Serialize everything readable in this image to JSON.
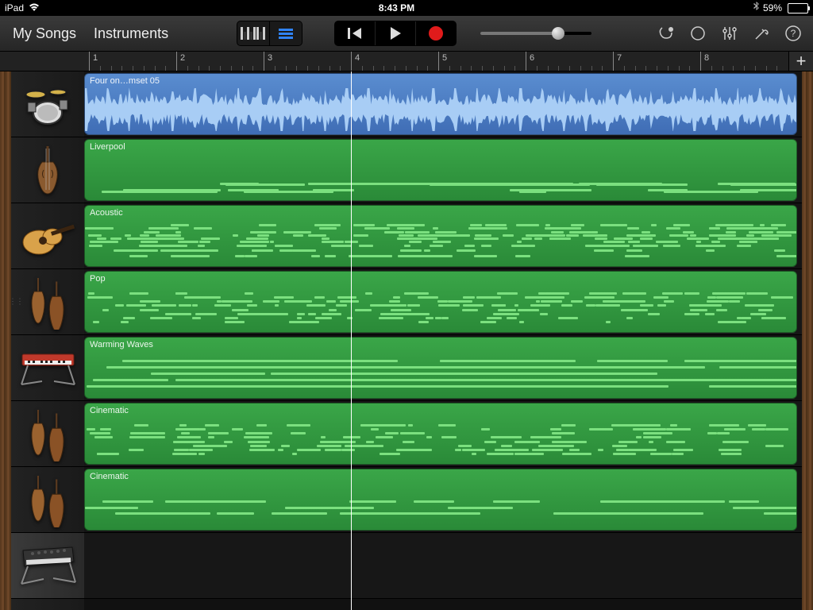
{
  "status": {
    "device": "iPad",
    "time": "8:43 PM",
    "battery_pct": "59%",
    "battery_fill": 59
  },
  "toolbar": {
    "my_songs": "My Songs",
    "instruments": "Instruments"
  },
  "ruler": {
    "bars": [
      "1",
      "2",
      "3",
      "4",
      "5",
      "6",
      "7",
      "8"
    ]
  },
  "playhead_bar": 4,
  "volume_pct": 70,
  "tracks": [
    {
      "name": "Four on…mset 05",
      "type": "audio",
      "instrument": "drums"
    },
    {
      "name": "Liverpool",
      "type": "midi",
      "instrument": "bass"
    },
    {
      "name": "Acoustic",
      "type": "midi",
      "instrument": "guitar"
    },
    {
      "name": "Pop",
      "type": "midi",
      "instrument": "strings"
    },
    {
      "name": "Warming Waves",
      "type": "midi",
      "instrument": "keyboard"
    },
    {
      "name": "Cinematic",
      "type": "midi",
      "instrument": "strings"
    },
    {
      "name": "Cinematic",
      "type": "midi",
      "instrument": "strings"
    },
    {
      "name": "",
      "type": "empty",
      "instrument": "synth"
    }
  ],
  "add_icon": "+"
}
